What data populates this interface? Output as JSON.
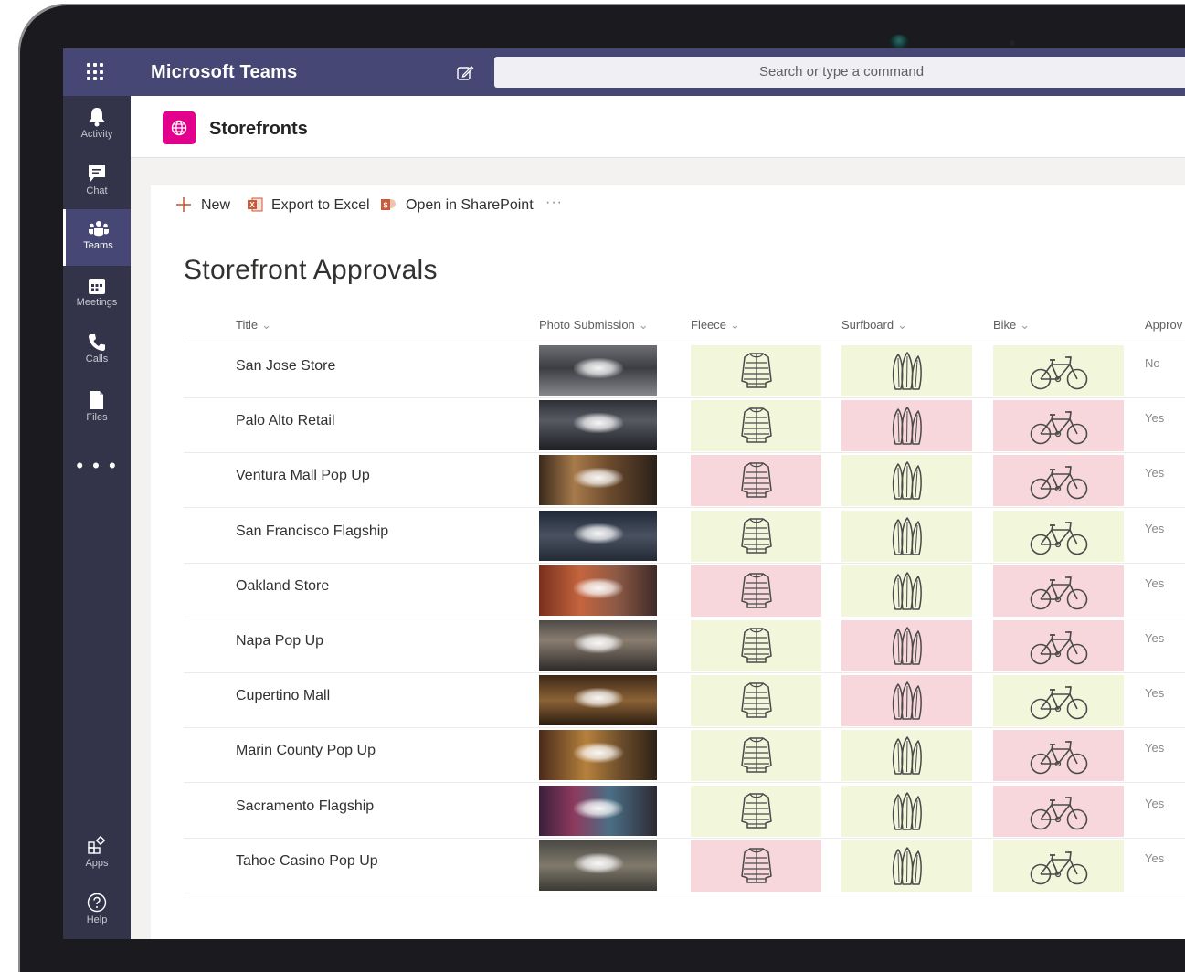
{
  "app": {
    "title": "Microsoft Teams",
    "search_placeholder": "Search or type a command"
  },
  "rail": {
    "items": [
      {
        "label": "Activity",
        "icon": "bell-icon"
      },
      {
        "label": "Chat",
        "icon": "chat-icon"
      },
      {
        "label": "Teams",
        "icon": "teams-icon",
        "active": true
      },
      {
        "label": "Meetings",
        "icon": "calendar-icon"
      },
      {
        "label": "Calls",
        "icon": "phone-icon"
      },
      {
        "label": "Files",
        "icon": "file-icon"
      }
    ],
    "more": "• • •",
    "bottom": [
      {
        "label": "Apps",
        "icon": "apps-icon"
      },
      {
        "label": "Help",
        "icon": "help-icon"
      }
    ]
  },
  "channel": {
    "title": "Storefronts",
    "icon": "globe-icon",
    "icon_color": "#e3008c"
  },
  "commands": {
    "new": "New",
    "export": "Export to Excel",
    "sharepoint": "Open in SharePoint",
    "more": "···"
  },
  "list": {
    "title": "Storefront Approvals",
    "columns": [
      "Title",
      "Photo Submission",
      "Fleece",
      "Surfboard",
      "Bike",
      "Approv"
    ],
    "colors": {
      "ok": "#f2f7dc",
      "bad": "#f8d7dc"
    },
    "rows": [
      {
        "title": "San Jose Store",
        "fleece": "ok",
        "surfboard": "ok",
        "bike": "ok",
        "approved": "No"
      },
      {
        "title": "Palo Alto Retail",
        "fleece": "ok",
        "surfboard": "bad",
        "bike": "bad",
        "approved": "Yes"
      },
      {
        "title": "Ventura Mall Pop Up",
        "fleece": "bad",
        "surfboard": "ok",
        "bike": "bad",
        "approved": "Yes"
      },
      {
        "title": "San Francisco Flagship",
        "fleece": "ok",
        "surfboard": "ok",
        "bike": "ok",
        "approved": "Yes"
      },
      {
        "title": "Oakland Store",
        "fleece": "bad",
        "surfboard": "ok",
        "bike": "bad",
        "approved": "Yes"
      },
      {
        "title": "Napa Pop Up",
        "fleece": "ok",
        "surfboard": "bad",
        "bike": "bad",
        "approved": "Yes"
      },
      {
        "title": "Cupertino Mall",
        "fleece": "ok",
        "surfboard": "bad",
        "bike": "ok",
        "approved": "Yes"
      },
      {
        "title": "Marin County Pop Up",
        "fleece": "ok",
        "surfboard": "ok",
        "bike": "bad",
        "approved": "Yes"
      },
      {
        "title": "Sacramento Flagship",
        "fleece": "ok",
        "surfboard": "ok",
        "bike": "bad",
        "approved": "Yes"
      },
      {
        "title": "Tahoe Casino Pop Up",
        "fleece": "bad",
        "surfboard": "ok",
        "bike": "ok",
        "approved": "Yes"
      }
    ]
  }
}
